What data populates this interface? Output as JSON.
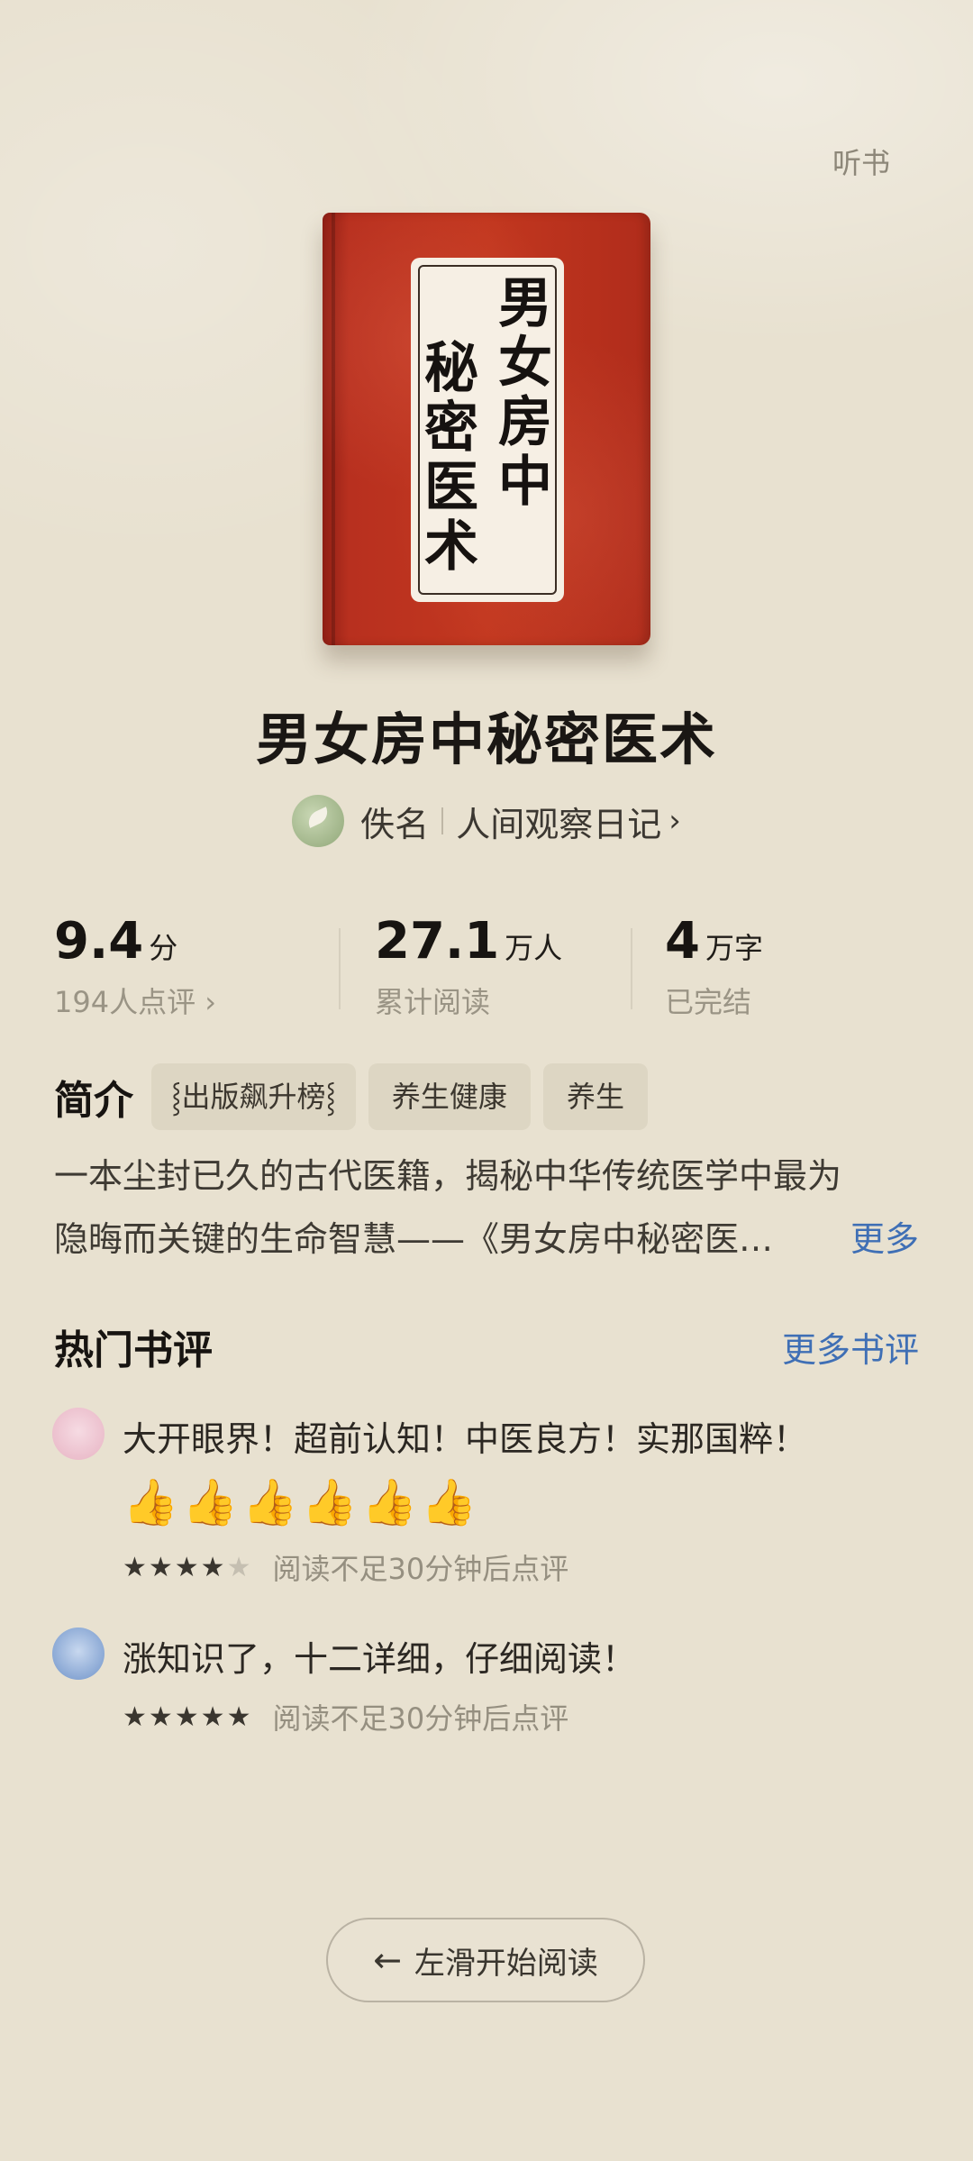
{
  "header": {
    "listen_label": "听书"
  },
  "cover": {
    "col_right": "男女房中",
    "col_left": "秘密医术"
  },
  "book": {
    "title": "男女房中秘密医术",
    "author": "佚名",
    "publisher": "人间观察日记",
    "publisher_chevron": "›"
  },
  "stats": {
    "rating": {
      "value": "9.4",
      "unit": "分",
      "sub": "194人点评 ›"
    },
    "reads": {
      "value": "27.1",
      "unit": "万人",
      "sub": "累计阅读"
    },
    "words": {
      "value": "4",
      "unit": "万字",
      "sub": "已完结"
    }
  },
  "intro": {
    "heading": "简介",
    "tags": [
      "⸾出版飙升榜⸾",
      "养生健康",
      "养生"
    ],
    "line1": "一本尘封已久的古代医籍，揭秘中华传统医学中最为",
    "line2": "隐晦而关键的生命智慧——《男女房中秘密医…",
    "more": "更多"
  },
  "reviews": {
    "title": "热门书评",
    "more": "更多书评",
    "items": [
      {
        "text": "大开眼界！超前认知！中医良方！实那国粹！",
        "emojis": "👍👍👍👍👍👍",
        "rating": 4,
        "stars_full": "★★★★",
        "stars_empty": "★",
        "meta": "阅读不足30分钟后点评"
      },
      {
        "text": "涨知识了，十二详细，仔细阅读！",
        "emojis": "",
        "rating": 5,
        "stars_full": "★★★★★",
        "stars_empty": "",
        "meta": "阅读不足30分钟后点评"
      }
    ]
  },
  "footer": {
    "start_label": "左滑开始阅读",
    "arrow": "←"
  },
  "colors": {
    "background": "#e8e1d0",
    "cover_red": "#c2371f",
    "link_blue": "#3f6fb5"
  }
}
